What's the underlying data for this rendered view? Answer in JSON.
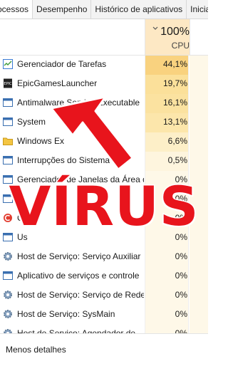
{
  "tabs": [
    {
      "label": "ocessos",
      "active": true
    },
    {
      "label": "Desempenho",
      "active": false
    },
    {
      "label": "Histórico de aplicativos",
      "active": false
    },
    {
      "label": "Inicializ",
      "active": false
    }
  ],
  "cpu_header": {
    "percent": "100%",
    "label": "CPU"
  },
  "processes": [
    {
      "name": "Gerenciador de Tarefas",
      "cpu": "44,1%",
      "icon": "task-manager-icon",
      "bg": "#f9d27f"
    },
    {
      "name": "EpicGamesLauncher",
      "cpu": "19,7%",
      "icon": "epic-games-icon",
      "bg": "#fbe09a"
    },
    {
      "name": "Antimalware Service Executable",
      "cpu": "16,1%",
      "icon": "service-window-icon",
      "bg": "#fbe2a0"
    },
    {
      "name": "System",
      "cpu": "13,1%",
      "icon": "service-window-icon",
      "bg": "#fce6ab"
    },
    {
      "name": "Windows Ex",
      "cpu": "6,6%",
      "icon": "folder-icon",
      "bg": "#fdefc8"
    },
    {
      "name": "Interrupções do Sistema",
      "cpu": "0,5%",
      "icon": "service-window-icon",
      "bg": "#fef5de"
    },
    {
      "name": "Gerenciador de Janelas da Área de Trabalho",
      "cpu": "0%",
      "icon": "service-window-icon",
      "bg": "#fef8e8"
    },
    {
      "name": "",
      "cpu": "0%",
      "icon": "service-window-icon",
      "bg": "#fef8e8"
    },
    {
      "name": "C",
      "cpu": "0%",
      "icon": "ccleaner-icon",
      "bg": "#fef8e8"
    },
    {
      "name": "Us",
      "cpu": "0%",
      "icon": "service-window-icon",
      "bg": "#fef8e8"
    },
    {
      "name": "Host de Serviço: Serviço Auxiliar",
      "cpu": "0%",
      "icon": "gear-icon",
      "bg": "#fef8e8"
    },
    {
      "name": "Aplicativo de serviços e controle",
      "cpu": "0%",
      "icon": "service-window-icon",
      "bg": "#fef8e8"
    },
    {
      "name": "Host de Serviço: Serviço de Rede",
      "cpu": "0%",
      "icon": "gear-icon",
      "bg": "#fef8e8"
    },
    {
      "name": "Host de Serviço: SysMain",
      "cpu": "0%",
      "icon": "gear-icon",
      "bg": "#fef8e8"
    },
    {
      "name": "Host de Serviço: Agendador de",
      "cpu": "0%",
      "icon": "gear-icon",
      "bg": "#fef8e8"
    }
  ],
  "footer": {
    "less_details": "Menos detalhes"
  },
  "overlay": {
    "text": "VÍRUS",
    "color": "#e8141c",
    "arrow_color": "#e8141c"
  }
}
